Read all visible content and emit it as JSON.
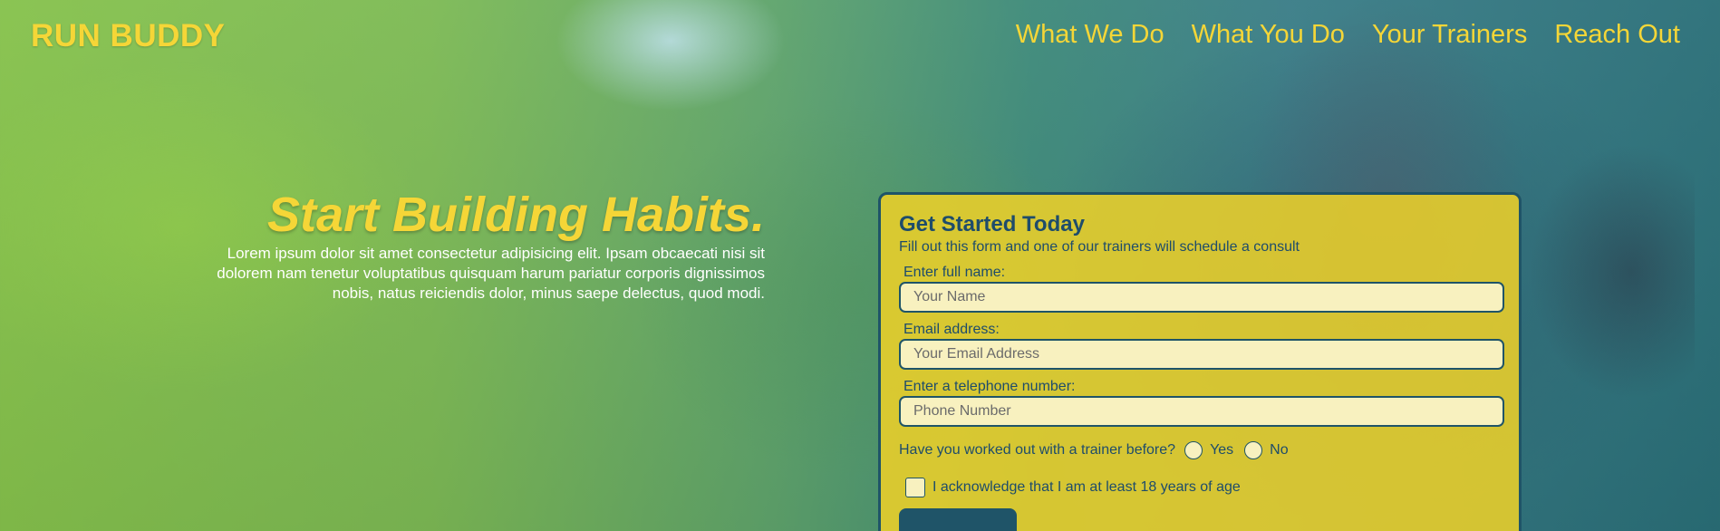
{
  "header": {
    "logo": "RUN BUDDY",
    "nav": [
      "What We Do",
      "What You Do",
      "Your Trainers",
      "Reach Out"
    ]
  },
  "hero": {
    "title": "Start Building Habits.",
    "text": "Lorem ipsum dolor sit amet consectetur adipisicing elit. Ipsam obcaecati nisi sit dolorem nam tenetur voluptatibus quisquam harum pariatur corporis dignissimos nobis, natus reiciendis dolor, minus saepe delectus, quod modi."
  },
  "form": {
    "title": "Get Started Today",
    "subtitle": "Fill out this form and one of our trainers will schedule a consult",
    "name_label": "Enter full name:",
    "name_placeholder": "Your Name",
    "email_label": "Email address:",
    "email_placeholder": "Your Email Address",
    "phone_label": "Enter a telephone number:",
    "phone_placeholder": "Phone Number",
    "trainer_question": "Have you worked out with a trainer before?",
    "yes_label": "Yes",
    "no_label": "No",
    "age_ack": "I acknowledge that I am at least 18 years of age"
  },
  "colors": {
    "accent_yellow": "#f5d637",
    "dark_blue": "#1e4c6b",
    "form_bg": "#f0d228"
  }
}
